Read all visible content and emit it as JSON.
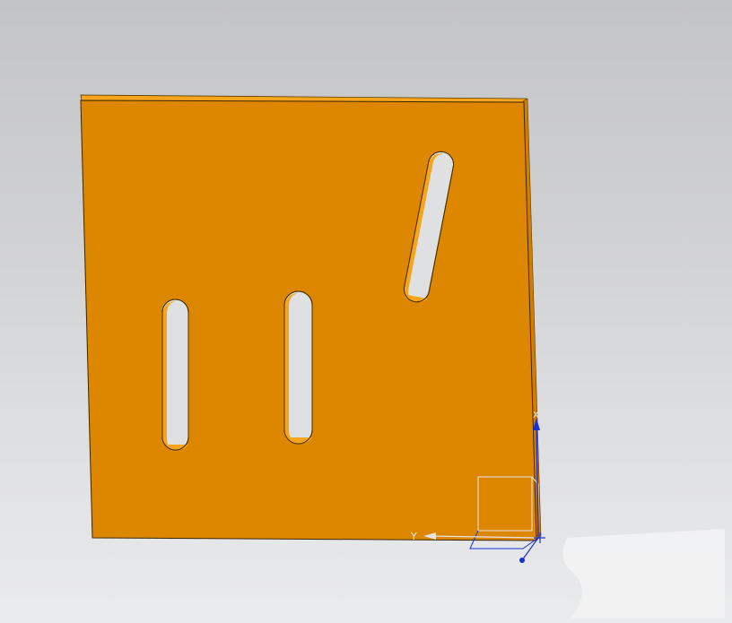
{
  "viewport": {
    "background_top": "#c3c4c6",
    "background_bottom": "#eaebec"
  },
  "part": {
    "face_color": "#dd8600",
    "edge_color": "#f4a21a",
    "slot_count": 3
  },
  "triad": {
    "x_label": "X",
    "y_label": "Y",
    "axis_color": "#1b2fd6",
    "icons": [
      "coordinate-triad-icon",
      "origin-point-icon"
    ]
  }
}
